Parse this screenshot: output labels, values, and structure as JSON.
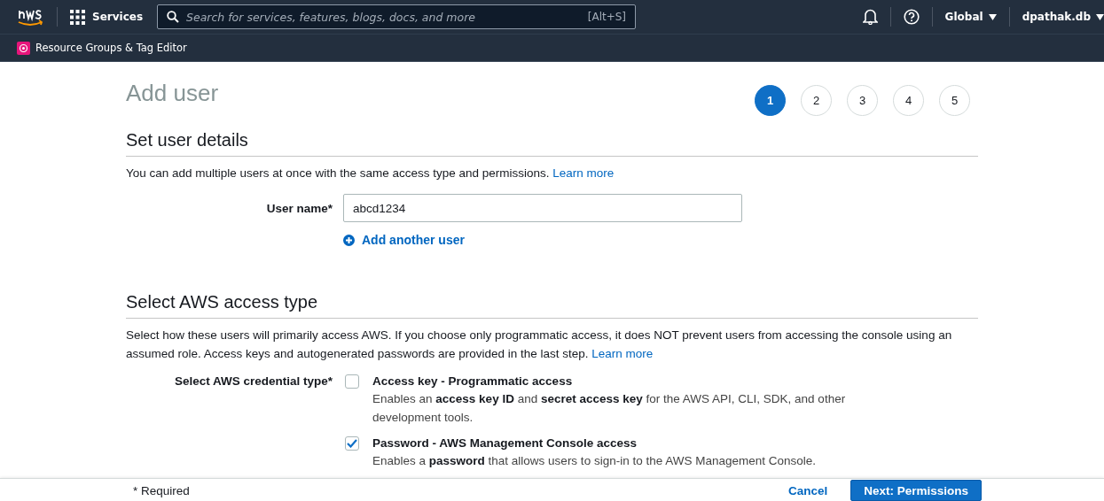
{
  "top_nav": {
    "services": "Services",
    "search": {
      "placeholder": "Search for services, features, blogs, docs, and more",
      "shortcut": "[Alt+S]"
    },
    "region": "Global",
    "account": "dpathak.db"
  },
  "favorites": [
    {
      "label": "Resource Groups & Tag Editor"
    }
  ],
  "page": {
    "title": "Add user",
    "steps": [
      {
        "label": "1",
        "selected": true
      },
      {
        "label": "2",
        "selected": false
      },
      {
        "label": "3",
        "selected": false
      },
      {
        "label": "4",
        "selected": false
      },
      {
        "label": "5",
        "selected": false
      }
    ]
  },
  "user_details": {
    "heading": "Set user details",
    "description": "You can add multiple users at once with the same access type and permissions.",
    "link": "Learn more",
    "user_name_label": "User name*",
    "user_name_value": "abcd1234",
    "add_another": "Add another user"
  },
  "access_type": {
    "heading": "Select AWS access type",
    "description": "Select how these users will primarily access AWS. If you choose only programmatic access, it does NOT prevent users from accessing the console using an assumed role. Access keys and autogenerated passwords are provided in the last step.",
    "link": "Learn more",
    "credential_label": "Select AWS credential type*",
    "options": [
      {
        "title": "Access key - Programmatic access",
        "description": "Enables an **access key ID** and **secret access key** for the AWS API, CLI, SDK, and other development tools.",
        "checked": false
      },
      {
        "title": "Password - AWS Management Console access",
        "description": "Enables a **password** that allows users to sign-in to the AWS Management Console.",
        "checked": true
      }
    ]
  },
  "footer": {
    "required_note": "* Required",
    "cancel": "Cancel",
    "next": "Next: Permissions"
  }
}
